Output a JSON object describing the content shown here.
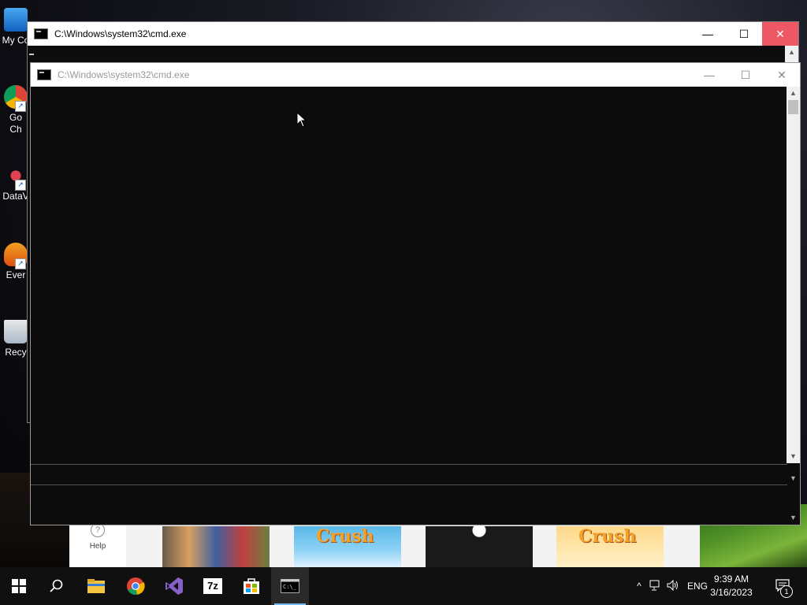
{
  "desktop": {
    "icons": [
      {
        "label": "My Co",
        "glyph": "monitor-icon"
      },
      {
        "label": "Go\nCh",
        "glyph": "chrome-icon"
      },
      {
        "label": "DataV",
        "glyph": "datav-icon"
      },
      {
        "label": "Ever",
        "glyph": "ever-icon"
      },
      {
        "label": "Recy",
        "glyph": "recycle-bin-icon"
      }
    ]
  },
  "store": {
    "help_label": "Help",
    "tiles": [
      {
        "name": "roblox-tile",
        "text": ""
      },
      {
        "name": "candy-crush-tile",
        "text": "Crush"
      },
      {
        "name": "dark-game-tile",
        "text": ""
      },
      {
        "name": "candy-crush-saga-tile",
        "text": "Crush"
      }
    ]
  },
  "back_window": {
    "title": "C:\\Windows\\system32\\cmd.exe",
    "minimize": "—",
    "maximize": "☐",
    "close": "✕"
  },
  "front_window": {
    "title": "C:\\Windows\\system32\\cmd.exe",
    "minimize": "—",
    "maximize": "☐",
    "close": "✕"
  },
  "taskbar": {
    "apps": [
      {
        "name": "start-button",
        "icon": "windows-logo-icon"
      },
      {
        "name": "search-button",
        "icon": "search-icon"
      },
      {
        "name": "file-explorer-button",
        "icon": "folder-icon"
      },
      {
        "name": "chrome-button",
        "icon": "chrome-icon"
      },
      {
        "name": "visual-studio-button",
        "icon": "visual-studio-icon"
      },
      {
        "name": "7zip-button",
        "icon": "7zip-icon",
        "text": "7z"
      },
      {
        "name": "store-button",
        "icon": "store-icon"
      },
      {
        "name": "cmd-button",
        "icon": "cmd-icon"
      }
    ],
    "tray_lang": "ENG",
    "time": "9:39 AM",
    "date": "3/16/2023",
    "notification_count": "1"
  },
  "colors": {
    "console_bg": "#0c0c0c",
    "taskbar_bg": "#101010",
    "accent": "#76b9ed"
  }
}
